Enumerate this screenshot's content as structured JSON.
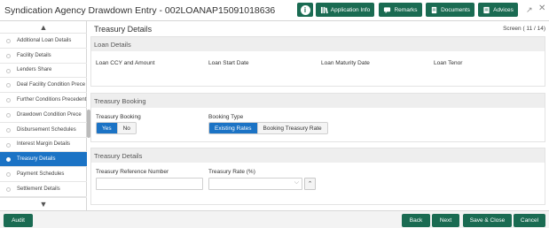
{
  "header": {
    "title": "Syndication Agency Drawdown Entry - 002LOANAP15091018636",
    "buttons": {
      "info_icon": "i",
      "application_info": "Application Info",
      "remarks": "Remarks",
      "documents": "Documents",
      "advices": "Advices"
    },
    "icons": {
      "expand": "expand-icon",
      "close": "close-icon"
    },
    "accent": "#1a6b52"
  },
  "sidebar": {
    "items": [
      {
        "label": "Additional Loan Details",
        "active": false
      },
      {
        "label": "Facility Details",
        "active": false
      },
      {
        "label": "Lenders Share",
        "active": false
      },
      {
        "label": "Deal Facility Condition Prece",
        "active": false
      },
      {
        "label": "Further Conditions Precedent",
        "active": false
      },
      {
        "label": "Drawdown Condition Prece",
        "active": false
      },
      {
        "label": "Disbursement Schedules",
        "active": false
      },
      {
        "label": "Interest Margin Details",
        "active": false
      },
      {
        "label": "Treasury Details",
        "active": true
      },
      {
        "label": "Payment Schedules",
        "active": false
      },
      {
        "label": "Settlement Details",
        "active": false
      }
    ],
    "active_color": "#1b73c5"
  },
  "main": {
    "page_title": "Treasury Details",
    "screen_count": "Screen ( 11 / 14)",
    "loan_details": {
      "heading": "Loan Details",
      "columns": [
        "Loan CCY and Amount",
        "Loan Start Date",
        "Loan Maturity Date",
        "Loan Tenor"
      ]
    },
    "treasury_booking": {
      "heading": "Treasury Booking",
      "booking_label": "Treasury Booking",
      "booking_options": {
        "yes": "Yes",
        "no": "No"
      },
      "booking_selected": "Yes",
      "type_label": "Booking Type",
      "type_options": {
        "existing": "Existing Rates",
        "booking": "Booking Treasury Rate"
      },
      "type_selected": "Existing Rates"
    },
    "treasury_details": {
      "heading": "Treasury Details",
      "ref_label": "Treasury Reference Number",
      "ref_value": "",
      "rate_label": "Treasury Rate (%)",
      "rate_value": ""
    }
  },
  "footer": {
    "audit": "Audit",
    "back": "Back",
    "next": "Next",
    "save_close": "Save & Close",
    "cancel": "Cancel"
  }
}
